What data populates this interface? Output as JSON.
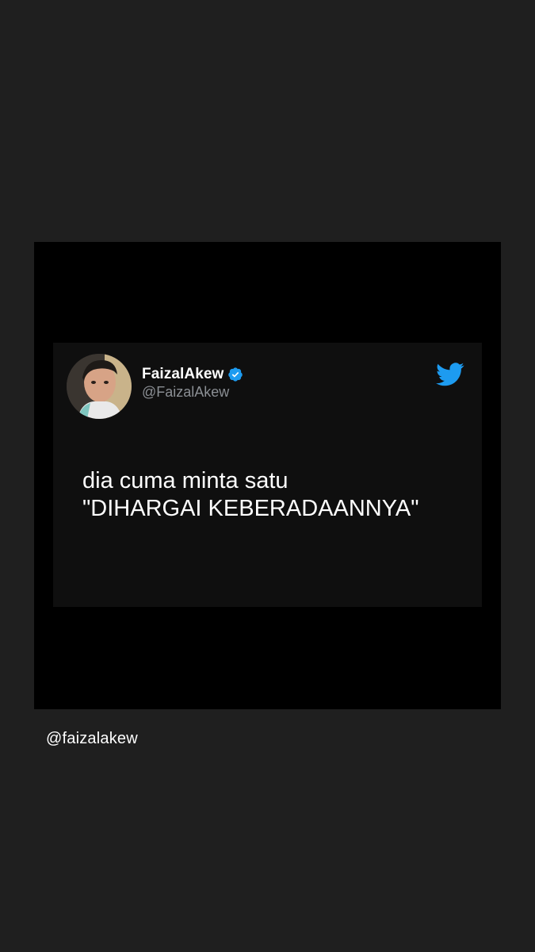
{
  "tweet": {
    "display_name": "FaizalAkew",
    "handle": "@FaizalAkew",
    "verified_icon": "verified-badge-icon",
    "platform_icon": "twitter-bird-icon",
    "text_lines": [
      "dia cuma minta satu",
      "\"DIHARGAI KEBERADAANNYA\""
    ]
  },
  "caption": {
    "mention": "@faizalakew"
  },
  "colors": {
    "background": "#1f1f1f",
    "frame": "#000000",
    "card": "#0f0f0f",
    "twitter_blue": "#1d9bf0",
    "handle_gray": "#8b8f94"
  }
}
